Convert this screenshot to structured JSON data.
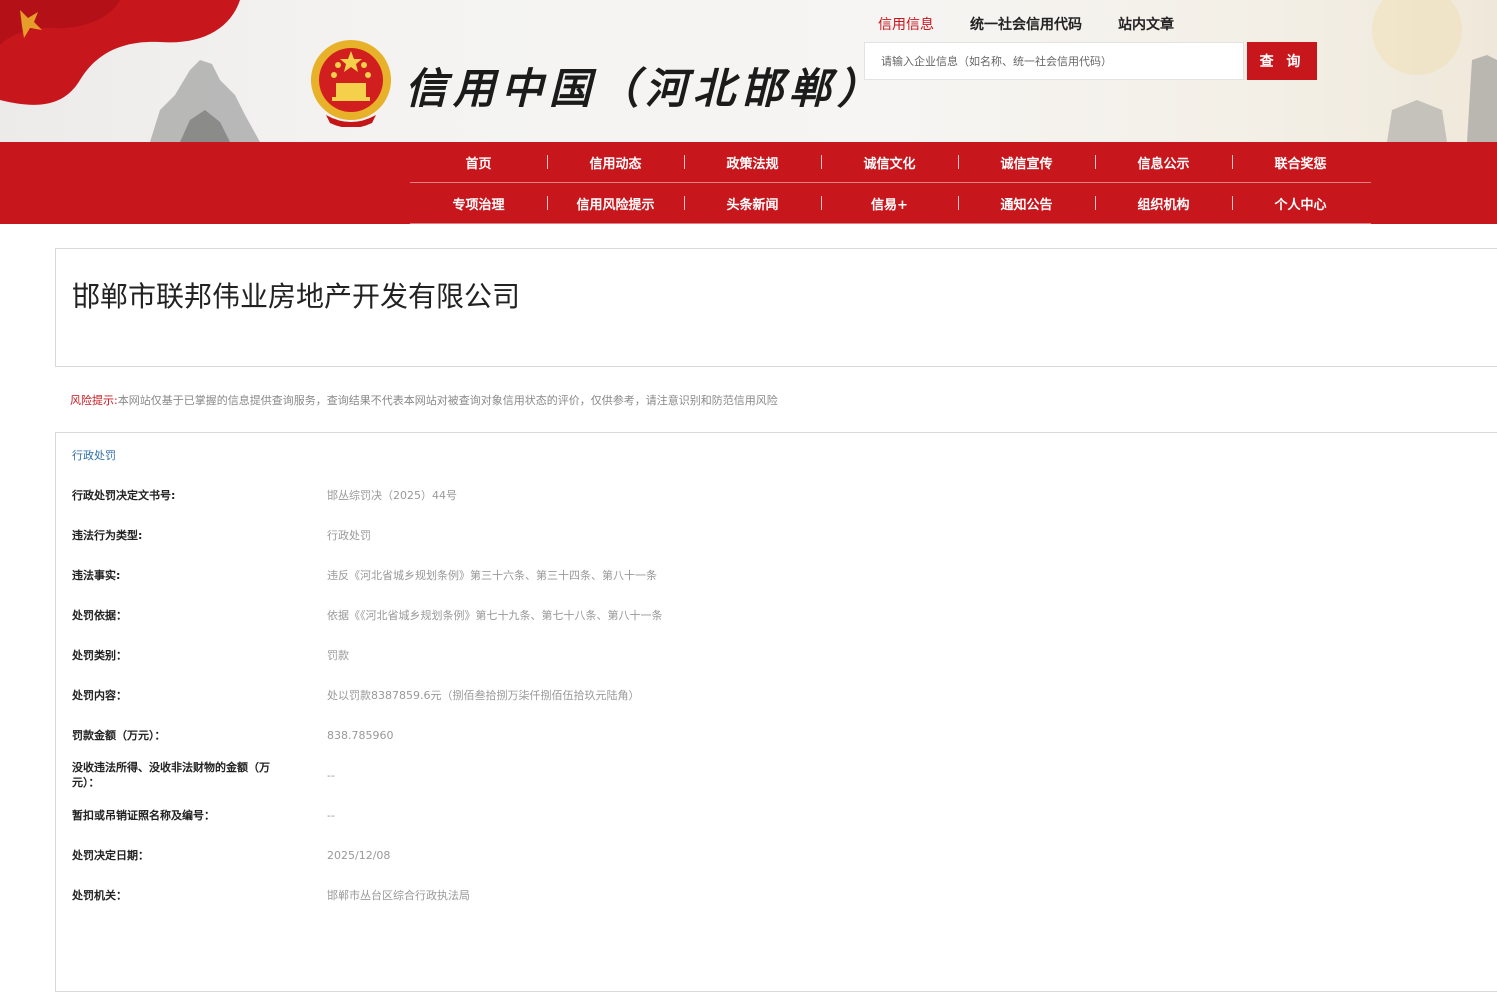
{
  "header": {
    "site_title": "信用中国（河北邯郸）",
    "top_links": [
      "信用信息",
      "统一社会信用代码",
      "站内文章"
    ],
    "search_placeholder": "请输入企业信息（如名称、统一社会信用代码）",
    "search_button": "查 询"
  },
  "nav": {
    "row1": [
      "首页",
      "信用动态",
      "政策法规",
      "诚信文化",
      "诚信宣传",
      "信息公示",
      "联合奖惩"
    ],
    "row2": [
      "专项治理",
      "信用风险提示",
      "头条新闻",
      "信易+",
      "通知公告",
      "组织机构",
      "个人中心"
    ]
  },
  "company": {
    "name": "邯郸市联邦伟业房地产开发有限公司"
  },
  "risk": {
    "label": "风险提示:",
    "text": "本网站仅基于已掌握的信息提供查询服务，查询结果不代表本网站对被查询对象信用状态的评价，仅供参考，请注意识别和防范信用风险"
  },
  "detail": {
    "tab": "行政处罚",
    "rows": [
      {
        "label": "行政处罚决定文书号:",
        "value": "邯丛综罚决（2025）44号"
      },
      {
        "label": "违法行为类型:",
        "value": "行政处罚"
      },
      {
        "label": "违法事实:",
        "value": "违反《河北省城乡规划条例》第三十六条、第三十四条、第八十一条"
      },
      {
        "label": "处罚依据：",
        "value": "依据《《河北省城乡规划条例》第七十九条、第七十八条、第八十一条"
      },
      {
        "label": "处罚类别：",
        "value": "罚款"
      },
      {
        "label": "处罚内容：",
        "value": "处以罚款8387859.6元（捌佰叁拾捌万柒仟捌佰伍拾玖元陆角）"
      },
      {
        "label": "罚款金额（万元）：",
        "value": "838.785960"
      },
      {
        "label": "没收违法所得、没收非法财物的金额（万元）：",
        "value": "--"
      },
      {
        "label": "暂扣或吊销证照名称及编号：",
        "value": "--"
      },
      {
        "label": "处罚决定日期：",
        "value": "2025/12/08"
      },
      {
        "label": "处罚机关：",
        "value": "邯郸市丛台区综合行政执法局"
      }
    ]
  },
  "colors": {
    "brand_red": "#c8161d",
    "link_blue": "#2f6fa8"
  }
}
